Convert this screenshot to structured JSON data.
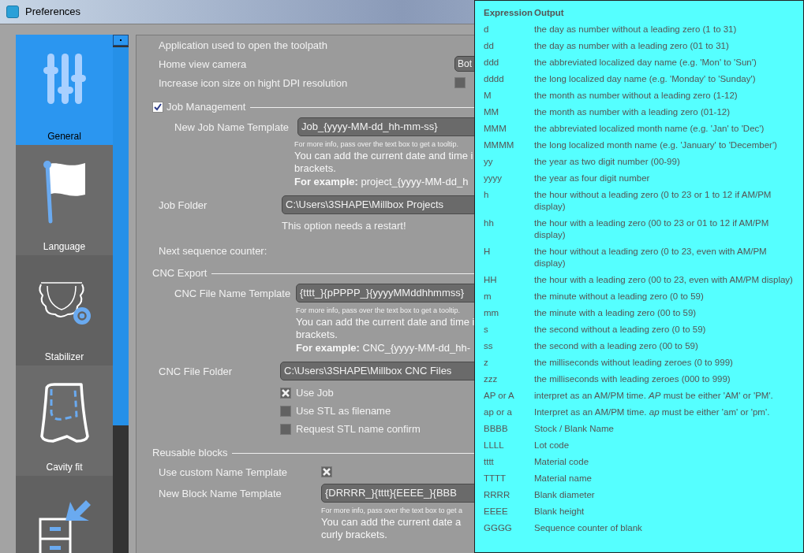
{
  "window": {
    "title": "Preferences"
  },
  "sidebar": {
    "items": [
      {
        "label": "General",
        "selected": true
      },
      {
        "label": "Language",
        "selected": false
      },
      {
        "label": "Stabilizer",
        "selected": false
      },
      {
        "label": "Cavity fit",
        "selected": false
      },
      {
        "selected": false
      }
    ]
  },
  "general": {
    "rows": [
      {
        "kind": "text",
        "label": "Application used to open the toolpath"
      },
      {
        "kind": "combo",
        "label": "Home view camera",
        "value": "Bot"
      },
      {
        "kind": "check",
        "label": "Increase icon size on hight DPI resolution",
        "checked": false
      }
    ]
  },
  "job_management": {
    "title": "Job Management",
    "checked": true,
    "name_template": {
      "label": "New Job Name Template",
      "value": "Job_{yyyy-MM-dd_hh-mm-ss}",
      "hint": "For more info, pass over the text box to get a tooltip.",
      "info": [
        "You can add the current date and time i",
        "brackets."
      ],
      "example": "**For example:** project_{yyyy-MM-dd_h"
    },
    "folder": {
      "label": "Job Folder",
      "value": "C:\\Users\\3SHAPE\\Millbox Projects",
      "note": "This option needs a restart!"
    },
    "counter_label": "Next sequence counter:"
  },
  "cnc_export": {
    "title": "CNC Export",
    "name_template": {
      "label": "CNC File Name Template",
      "value": "{tttt_}{pPPPP_}{yyyyMMddhhmmss}",
      "hint": "For more info, pass over the text box to get a tooltip.",
      "info": [
        "You can add the current date and time i",
        "brackets."
      ],
      "example": "**For example:** CNC_{yyyy-MM-dd_hh-"
    },
    "folder": {
      "label": "CNC File Folder",
      "value": "C:\\Users\\3SHAPE\\Millbox CNC Files"
    },
    "options": [
      {
        "label": "Use Job",
        "checked": true
      },
      {
        "label": "Use STL as filename",
        "checked": false
      },
      {
        "label": "Request STL name confirm",
        "checked": false
      }
    ]
  },
  "reusable_blocks": {
    "title": "Reusable blocks",
    "custom_template": {
      "label": "Use custom Name Template",
      "checked": true
    },
    "name_template": {
      "label": "New Block Name Template",
      "value": "{DRRRR_}{tttt}{EEEE_}{BBB",
      "hint": "For more info, pass over the text box to get a",
      "info": [
        "You can add the current date a",
        "curly brackets."
      ]
    }
  },
  "tooltip": {
    "columns": [
      "Expression",
      "Output"
    ],
    "rows": [
      {
        "expression": "d",
        "output": "the day as number without a leading zero (1 to 31)"
      },
      {
        "expression": "dd",
        "output": "the day as number with a leading zero (01 to 31)"
      },
      {
        "expression": "ddd",
        "output": "the abbreviated localized day name (e.g. 'Mon' to 'Sun')"
      },
      {
        "expression": "dddd",
        "output": "the long localized day name (e.g. 'Monday' to 'Sunday')"
      },
      {
        "expression": "M",
        "output": "the month as number without a leading zero (1-12)"
      },
      {
        "expression": "MM",
        "output": "the month as number with a leading zero (01-12)"
      },
      {
        "expression": "MMM",
        "output": "the abbreviated localized month name (e.g. 'Jan' to 'Dec')"
      },
      {
        "expression": "MMMM",
        "output": "the long localized month name (e.g. 'January' to 'December')"
      },
      {
        "expression": "yy",
        "output": "the year as two digit number (00-99)"
      },
      {
        "expression": "yyyy",
        "output": "the year as four digit number"
      },
      {
        "expression": "h",
        "output": "the hour without a leading zero (0 to 23 or 1 to 12 if AM/PM display)"
      },
      {
        "expression": "hh",
        "output": "the hour with a leading zero (00 to 23 or 01 to 12 if AM/PM display)"
      },
      {
        "expression": "H",
        "output": "the hour without a leading zero (0 to 23, even with AM/PM display)"
      },
      {
        "expression": "HH",
        "output": "the hour with a leading zero (00 to 23, even with AM/PM display)"
      },
      {
        "expression": "m",
        "output": "the minute without a leading zero (0 to 59)"
      },
      {
        "expression": "mm",
        "output": "the minute with a leading zero (00 to 59)"
      },
      {
        "expression": "s",
        "output": "the second without a leading zero (0 to 59)"
      },
      {
        "expression": "ss",
        "output": "the second with a leading zero (00 to 59)"
      },
      {
        "expression": "z",
        "output": "the milliseconds without leading zeroes (0 to 999)"
      },
      {
        "expression": "zzz",
        "output": "the milliseconds with leading zeroes (000 to 999)"
      },
      {
        "expression": "AP or A",
        "output": "interpret as an AM/PM time. *AP* must be either 'AM' or 'PM'."
      },
      {
        "expression": "ap or a",
        "output": "Interpret as an AM/PM time. *ap* must be either 'am' or 'pm'."
      },
      {
        "expression": "BBBB",
        "output": "Stock / Blank Name"
      },
      {
        "expression": "LLLL",
        "output": "Lot code"
      },
      {
        "expression": "tttt",
        "output": "Material code"
      },
      {
        "expression": "TTTT",
        "output": "Material name"
      },
      {
        "expression": "RRRR",
        "output": "Blank diameter"
      },
      {
        "expression": "EEEE",
        "output": "Blank height"
      },
      {
        "expression": "GGGG",
        "output": "Sequence counter of blank"
      }
    ]
  }
}
